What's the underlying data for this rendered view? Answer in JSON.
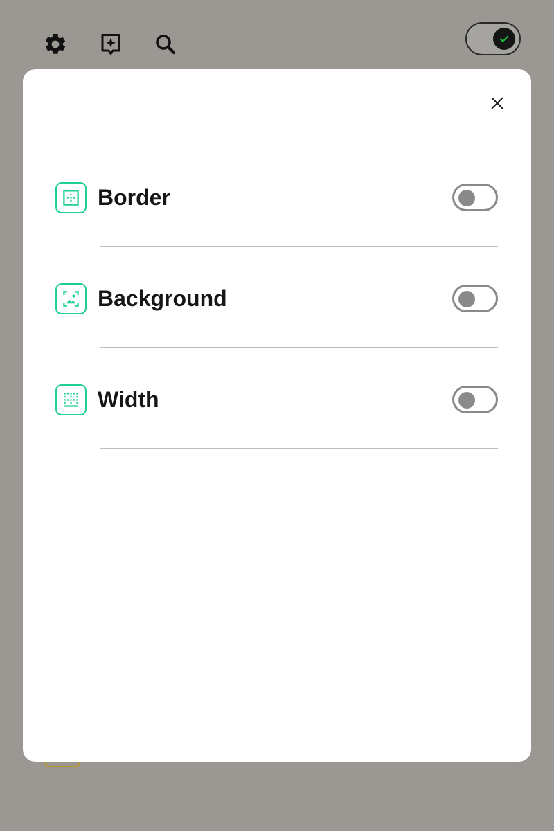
{
  "toolbar": {
    "icons": [
      "gear-icon",
      "sparkle-bookmark-icon",
      "search-icon"
    ],
    "theme_toggle_on": true
  },
  "modal": {
    "close_icon": "close-icon",
    "rows": [
      {
        "label": "Border",
        "icon": "border-icon",
        "enabled": false
      },
      {
        "label": "Background",
        "icon": "background-image-icon",
        "enabled": false
      },
      {
        "label": "Width",
        "icon": "width-icon",
        "enabled": false
      }
    ]
  },
  "colors": {
    "accent": "#1fcf94",
    "overlay": "#9b9894",
    "switch_off": "#8a8a8a",
    "text": "#161616",
    "check": "#1dbf3a"
  }
}
